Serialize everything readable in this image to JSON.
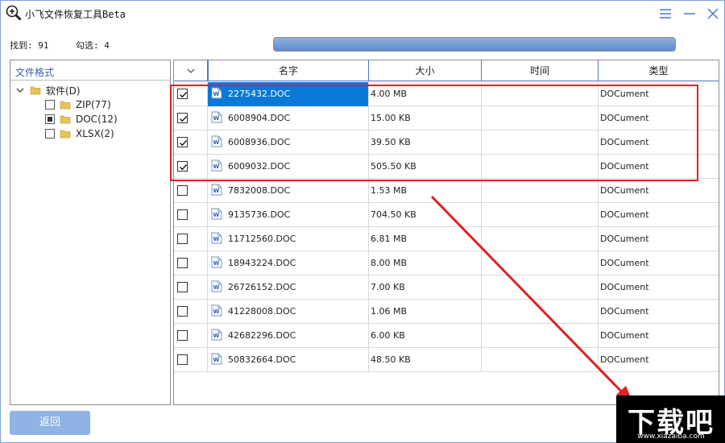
{
  "window": {
    "title": "小飞文件恢复工具Beta"
  },
  "status": {
    "found": "找到: 91",
    "checked": "勾选: 4",
    "progress": 1.0
  },
  "tree": {
    "header": "文件格式",
    "root": "软件(D)",
    "items": [
      {
        "label": "ZIP(77)",
        "state": "unchecked"
      },
      {
        "label": "DOC(12)",
        "state": "partial"
      },
      {
        "label": "XLSX(2)",
        "state": "unchecked"
      }
    ]
  },
  "table": {
    "columns": [
      "名字",
      "大小",
      "时间",
      "类型"
    ],
    "rows": [
      {
        "checked": true,
        "name": "2275432.DOC",
        "size": "4.00 MB",
        "time": "",
        "type": "DOCument",
        "selected": true
      },
      {
        "checked": true,
        "name": "6008904.DOC",
        "size": "15.00 KB",
        "time": "",
        "type": "DOCument"
      },
      {
        "checked": true,
        "name": "6008936.DOC",
        "size": "39.50 KB",
        "time": "",
        "type": "DOCument"
      },
      {
        "checked": true,
        "name": "6009032.DOC",
        "size": "505.50 KB",
        "time": "",
        "type": "DOCument"
      },
      {
        "checked": false,
        "name": "7832008.DOC",
        "size": "1.53 MB",
        "time": "",
        "type": "DOCument"
      },
      {
        "checked": false,
        "name": "9135736.DOC",
        "size": "704.50 KB",
        "time": "",
        "type": "DOCument"
      },
      {
        "checked": false,
        "name": "11712560.DOC",
        "size": "6.81 MB",
        "time": "",
        "type": "DOCument"
      },
      {
        "checked": false,
        "name": "18943224.DOC",
        "size": "8.00 MB",
        "time": "",
        "type": "DOCument"
      },
      {
        "checked": false,
        "name": "26726152.DOC",
        "size": "7.00 KB",
        "time": "",
        "type": "DOCument"
      },
      {
        "checked": false,
        "name": "41228008.DOC",
        "size": "1.06 MB",
        "time": "",
        "type": "DOCument"
      },
      {
        "checked": false,
        "name": "42682296.DOC",
        "size": "6.00 KB",
        "time": "",
        "type": "DOCument"
      },
      {
        "checked": false,
        "name": "50832664.DOC",
        "size": "48.50 KB",
        "time": "",
        "type": "DOCument"
      }
    ]
  },
  "buttons": {
    "back": "返回"
  },
  "watermark": {
    "text": "下载吧",
    "url": "www.xiazaiba.com"
  },
  "colors": {
    "accent": "#0a78d7",
    "highlight": "#e02020",
    "header_border": "#4a76c6"
  }
}
